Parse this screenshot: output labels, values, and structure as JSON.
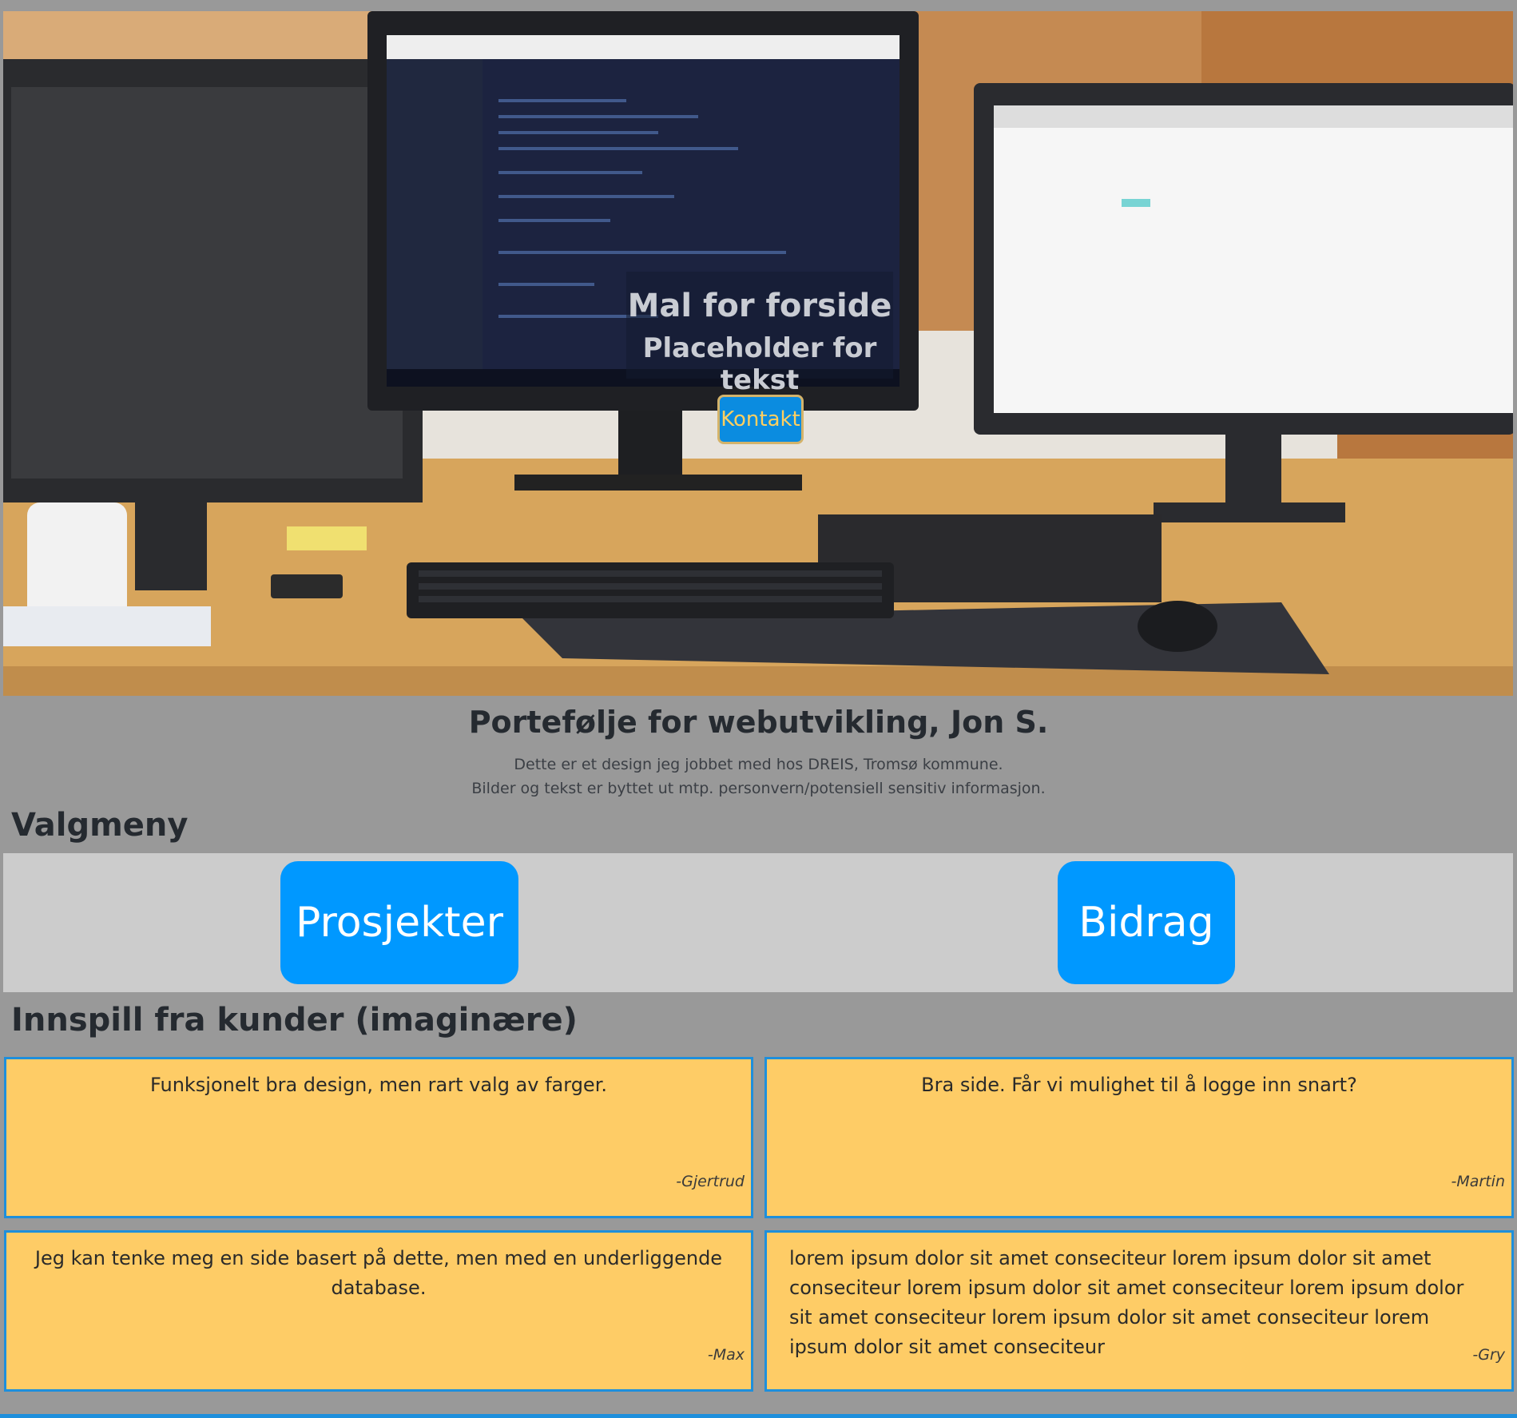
{
  "hero": {
    "title": "Mal for forside",
    "subtitle": "Placeholder for tekst",
    "button_label": "Kontakt",
    "image_icon": "desk-workstation-photo"
  },
  "intro": {
    "title": "Portefølje for webutvikling, Jon S.",
    "line1": "Dette er et design jeg jobbet med hos DREIS, Tromsø kommune.",
    "line2": "Bilder og tekst er byttet ut mtp. personvern/potensiell sensitiv informasjon."
  },
  "menu": {
    "heading": "Valgmeny",
    "buttons": [
      {
        "label": "Prosjekter"
      },
      {
        "label": "Bidrag"
      }
    ]
  },
  "feedback": {
    "heading": "Innspill fra kunder (imaginære)",
    "cards": [
      {
        "text": "Funksjonelt bra design, men rart valg av farger.",
        "author": "-Gjertrud"
      },
      {
        "text": "Bra side. Får vi mulighet til å logge inn snart?",
        "author": "-Martin"
      },
      {
        "text": "Jeg kan tenke meg en side basert på dette, men med en underliggende database.",
        "author": "-Max"
      },
      {
        "text": "lorem ipsum dolor sit amet conseciteur lorem ipsum dolor sit amet conseciteur lorem ipsum dolor sit amet conseciteur lorem ipsum dolor sit amet conseciteur lorem ipsum dolor sit amet conseciteur lorem ipsum dolor sit amet conseciteur",
        "author": "-Gry"
      }
    ]
  },
  "colors": {
    "page_background": "#999999",
    "menu_band": "#cccccc",
    "menu_button": "#0098ff",
    "card_background": "#fecc66",
    "card_border": "#1e8fdc"
  }
}
